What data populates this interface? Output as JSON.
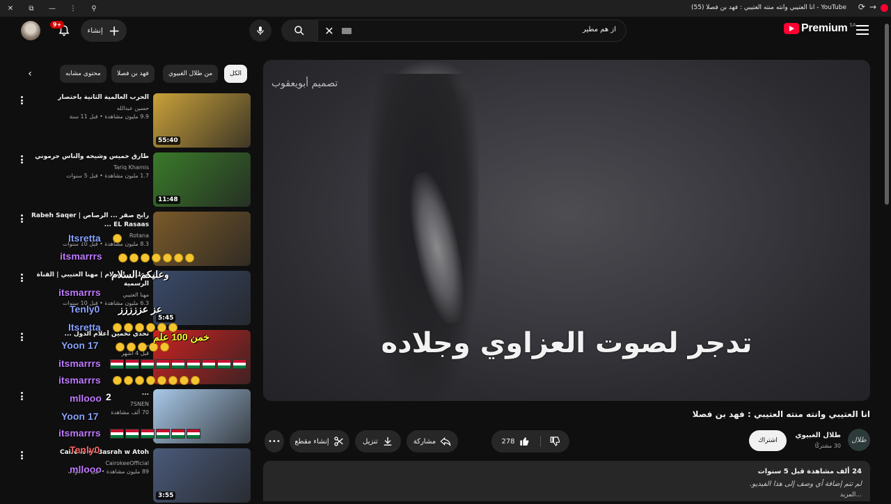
{
  "window": {
    "title": "YouTube - انا العتيبي وانته منته العتيبي : فهد بن فصلا (55)",
    "controls": [
      "close-icon",
      "restore-icon",
      "minimize-icon",
      "more-vert-icon",
      "pin-icon"
    ]
  },
  "header": {
    "notification_count": "9+",
    "create_label": "إنشاء",
    "search_value": "از هم مطير",
    "logo_text": "Premium",
    "logo_region": "SA"
  },
  "chips": [
    "الكل",
    "من طلال الغبيوي",
    "فهد بن فصلا",
    "محتوى مشابه"
  ],
  "recommendations": [
    {
      "title": "الحرب العالمية الثانية باختصار",
      "channel": "حسين عبدالله",
      "views": "9.9 مليون مشاهدة • قبل 11 سنة",
      "duration": "55:40",
      "thumb_color": "#c9a13a"
    },
    {
      "title": "طارق خميس وشيخه والناس حرموني",
      "channel": "Tariq Khamis",
      "views": "1.7 مليون مشاهدة • قبل 5 سنوات",
      "duration": "11:48",
      "thumb_color": "#3a7a2a"
    },
    {
      "title": "رابح صقر ... الرصاص | Rabeh Saqer ... EL Rasaas",
      "channel": "Rotana",
      "views": "8.3 مليون مشاهدة • قبل 10 سنوات",
      "duration": "",
      "thumb_color": "#7a5a2a"
    },
    {
      "title": "وعليكم السلام | مهنا العتيبي | القناة الرسمية",
      "channel": "مهنا العتيبي",
      "views": "6.3 مليون مشاهدة • قبل 10 سنوات",
      "duration": "5:45",
      "thumb_color": "#3a4a6a"
    },
    {
      "title": "تحدي تخمين أعلام الدول ...",
      "channel": "سهل",
      "views": "قبل 4 أشهر",
      "duration": "",
      "thumb_color": "#c22"
    },
    {
      "title": "...",
      "channel": "7SNEN",
      "views": "70 ألف مشاهدة",
      "duration": "",
      "thumb_color": "#a8c8e8"
    },
    {
      "title": "Cairokee - Basrah w Atoh",
      "channel": "CairokeeOfficial",
      "views": "89 مليون مشاهدة • قبل 3 سنوات",
      "duration": "3:55",
      "thumb_color": "#4a5a7a"
    }
  ],
  "chat_overlay": {
    "names": [
      "Itsretta",
      "itsmarrrs",
      "itsmarrrs",
      "Tenly0",
      "Itsretta",
      "Yoon 17",
      "itsmarrrs",
      "itsmarrrs",
      "mllooo",
      "Yoon 17",
      "itsmarrrs",
      "Tenly0",
      "mllooo"
    ],
    "messages": [
      "وعليكم السلام",
      "عز عززززز",
      "خمن 100 علم",
      "2"
    ],
    "name_colors": [
      "#8aa4ff",
      "#c07bff",
      "#c07bff",
      "#8aa4ff",
      "#8aa4ff",
      "#8aa4ff",
      "#c07bff",
      "#c07bff",
      "#c07bff",
      "#8aa4ff",
      "#c07bff",
      "#ff6a6a",
      "#c07bff"
    ]
  },
  "player": {
    "watermark": "تصميم أبويعقوب",
    "caption": "تدجر لصوت العزاوي وجلاده"
  },
  "video": {
    "title": "انا العتيبي وانته منته العتيبي : فهد بن فصلا",
    "channel_name": "طلال الغبيوي",
    "channel_subs": "30 مشتركًا",
    "channel_avatar_text": "طلال",
    "subscribe_label": "اشتراك",
    "like_count": "278",
    "share_label": "مشاركة",
    "download_label": "تنزيل",
    "clip_label": "إنشاء مقطع"
  },
  "description": {
    "views_age": "24 ألف مشاهدة  قبل 5 سنوات",
    "text": "لم تتم إضافة أي وصف إلى هذا الفيديو.",
    "more": "...المزيد"
  },
  "colors": {
    "accent_red": "#ff0033",
    "background": "#0f0f0f",
    "surface": "#272727"
  }
}
